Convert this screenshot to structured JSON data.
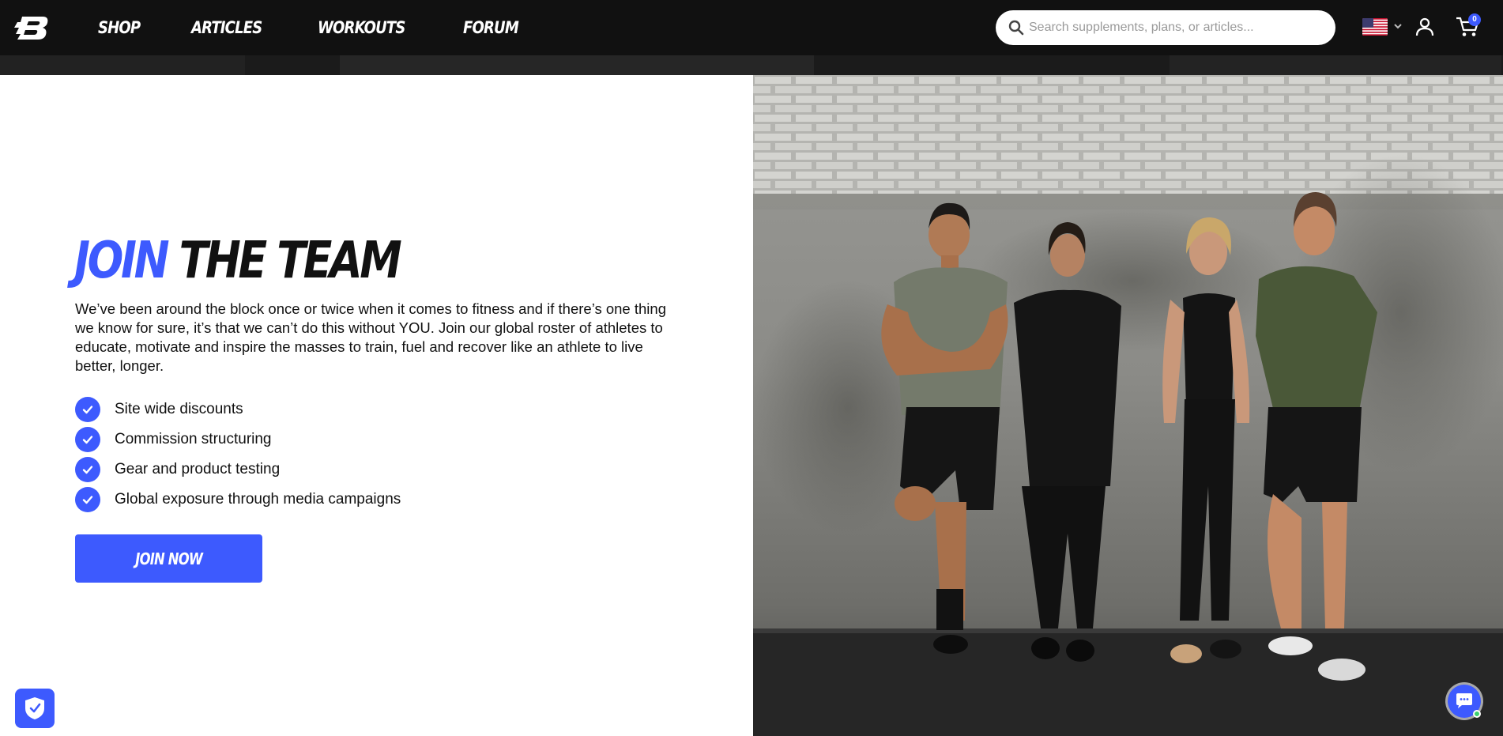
{
  "nav": {
    "links": [
      "SHOP",
      "ARTICLES",
      "WORKOUTS",
      "FORUM"
    ],
    "search_placeholder": "Search supplements, plans, or articles...",
    "cart_count": "0"
  },
  "hero": {
    "headline_accent": "JOIN",
    "headline_rest": "THE TEAM",
    "intro": "We’ve been around the block once or twice when it comes to fitness and if there’s one thing we know for sure, it’s that we can’t do this without YOU. Join our global roster of athletes to educate, motivate and inspire the masses to train, fuel and recover like an athlete to live better, longer.",
    "benefits": [
      "Site wide discounts",
      "Commission structuring",
      "Gear and product testing",
      "Global exposure through media campaigns"
    ],
    "cta_label": "JOIN NOW"
  },
  "colors": {
    "accent": "#3d5afe",
    "nav_bg": "#111111"
  },
  "icons": [
    "brand-logo-icon",
    "search-icon",
    "us-flag-icon",
    "chevron-down-icon",
    "user-icon",
    "cart-icon",
    "check-icon",
    "shield-icon",
    "chat-icon"
  ]
}
